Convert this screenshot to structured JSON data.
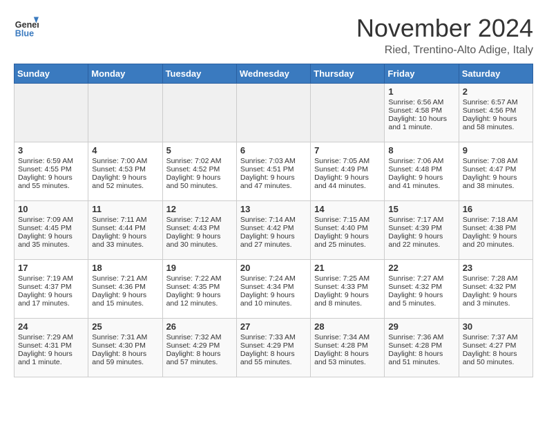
{
  "header": {
    "logo_general": "General",
    "logo_blue": "Blue",
    "title": "November 2024",
    "location": "Ried, Trentino-Alto Adige, Italy"
  },
  "columns": [
    "Sunday",
    "Monday",
    "Tuesday",
    "Wednesday",
    "Thursday",
    "Friday",
    "Saturday"
  ],
  "weeks": [
    {
      "days": [
        {
          "num": "",
          "content": "",
          "empty": true
        },
        {
          "num": "",
          "content": "",
          "empty": true
        },
        {
          "num": "",
          "content": "",
          "empty": true
        },
        {
          "num": "",
          "content": "",
          "empty": true
        },
        {
          "num": "",
          "content": "",
          "empty": true
        },
        {
          "num": "1",
          "content": "Sunrise: 6:56 AM\nSunset: 4:58 PM\nDaylight: 10 hours and 1 minute.",
          "empty": false
        },
        {
          "num": "2",
          "content": "Sunrise: 6:57 AM\nSunset: 4:56 PM\nDaylight: 9 hours and 58 minutes.",
          "empty": false
        }
      ]
    },
    {
      "days": [
        {
          "num": "3",
          "content": "Sunrise: 6:59 AM\nSunset: 4:55 PM\nDaylight: 9 hours and 55 minutes.",
          "empty": false
        },
        {
          "num": "4",
          "content": "Sunrise: 7:00 AM\nSunset: 4:53 PM\nDaylight: 9 hours and 52 minutes.",
          "empty": false
        },
        {
          "num": "5",
          "content": "Sunrise: 7:02 AM\nSunset: 4:52 PM\nDaylight: 9 hours and 50 minutes.",
          "empty": false
        },
        {
          "num": "6",
          "content": "Sunrise: 7:03 AM\nSunset: 4:51 PM\nDaylight: 9 hours and 47 minutes.",
          "empty": false
        },
        {
          "num": "7",
          "content": "Sunrise: 7:05 AM\nSunset: 4:49 PM\nDaylight: 9 hours and 44 minutes.",
          "empty": false
        },
        {
          "num": "8",
          "content": "Sunrise: 7:06 AM\nSunset: 4:48 PM\nDaylight: 9 hours and 41 minutes.",
          "empty": false
        },
        {
          "num": "9",
          "content": "Sunrise: 7:08 AM\nSunset: 4:47 PM\nDaylight: 9 hours and 38 minutes.",
          "empty": false
        }
      ]
    },
    {
      "days": [
        {
          "num": "10",
          "content": "Sunrise: 7:09 AM\nSunset: 4:45 PM\nDaylight: 9 hours and 35 minutes.",
          "empty": false
        },
        {
          "num": "11",
          "content": "Sunrise: 7:11 AM\nSunset: 4:44 PM\nDaylight: 9 hours and 33 minutes.",
          "empty": false
        },
        {
          "num": "12",
          "content": "Sunrise: 7:12 AM\nSunset: 4:43 PM\nDaylight: 9 hours and 30 minutes.",
          "empty": false
        },
        {
          "num": "13",
          "content": "Sunrise: 7:14 AM\nSunset: 4:42 PM\nDaylight: 9 hours and 27 minutes.",
          "empty": false
        },
        {
          "num": "14",
          "content": "Sunrise: 7:15 AM\nSunset: 4:40 PM\nDaylight: 9 hours and 25 minutes.",
          "empty": false
        },
        {
          "num": "15",
          "content": "Sunrise: 7:17 AM\nSunset: 4:39 PM\nDaylight: 9 hours and 22 minutes.",
          "empty": false
        },
        {
          "num": "16",
          "content": "Sunrise: 7:18 AM\nSunset: 4:38 PM\nDaylight: 9 hours and 20 minutes.",
          "empty": false
        }
      ]
    },
    {
      "days": [
        {
          "num": "17",
          "content": "Sunrise: 7:19 AM\nSunset: 4:37 PM\nDaylight: 9 hours and 17 minutes.",
          "empty": false
        },
        {
          "num": "18",
          "content": "Sunrise: 7:21 AM\nSunset: 4:36 PM\nDaylight: 9 hours and 15 minutes.",
          "empty": false
        },
        {
          "num": "19",
          "content": "Sunrise: 7:22 AM\nSunset: 4:35 PM\nDaylight: 9 hours and 12 minutes.",
          "empty": false
        },
        {
          "num": "20",
          "content": "Sunrise: 7:24 AM\nSunset: 4:34 PM\nDaylight: 9 hours and 10 minutes.",
          "empty": false
        },
        {
          "num": "21",
          "content": "Sunrise: 7:25 AM\nSunset: 4:33 PM\nDaylight: 9 hours and 8 minutes.",
          "empty": false
        },
        {
          "num": "22",
          "content": "Sunrise: 7:27 AM\nSunset: 4:32 PM\nDaylight: 9 hours and 5 minutes.",
          "empty": false
        },
        {
          "num": "23",
          "content": "Sunrise: 7:28 AM\nSunset: 4:32 PM\nDaylight: 9 hours and 3 minutes.",
          "empty": false
        }
      ]
    },
    {
      "days": [
        {
          "num": "24",
          "content": "Sunrise: 7:29 AM\nSunset: 4:31 PM\nDaylight: 9 hours and 1 minute.",
          "empty": false
        },
        {
          "num": "25",
          "content": "Sunrise: 7:31 AM\nSunset: 4:30 PM\nDaylight: 8 hours and 59 minutes.",
          "empty": false
        },
        {
          "num": "26",
          "content": "Sunrise: 7:32 AM\nSunset: 4:29 PM\nDaylight: 8 hours and 57 minutes.",
          "empty": false
        },
        {
          "num": "27",
          "content": "Sunrise: 7:33 AM\nSunset: 4:29 PM\nDaylight: 8 hours and 55 minutes.",
          "empty": false
        },
        {
          "num": "28",
          "content": "Sunrise: 7:34 AM\nSunset: 4:28 PM\nDaylight: 8 hours and 53 minutes.",
          "empty": false
        },
        {
          "num": "29",
          "content": "Sunrise: 7:36 AM\nSunset: 4:28 PM\nDaylight: 8 hours and 51 minutes.",
          "empty": false
        },
        {
          "num": "30",
          "content": "Sunrise: 7:37 AM\nSunset: 4:27 PM\nDaylight: 8 hours and 50 minutes.",
          "empty": false
        }
      ]
    }
  ]
}
